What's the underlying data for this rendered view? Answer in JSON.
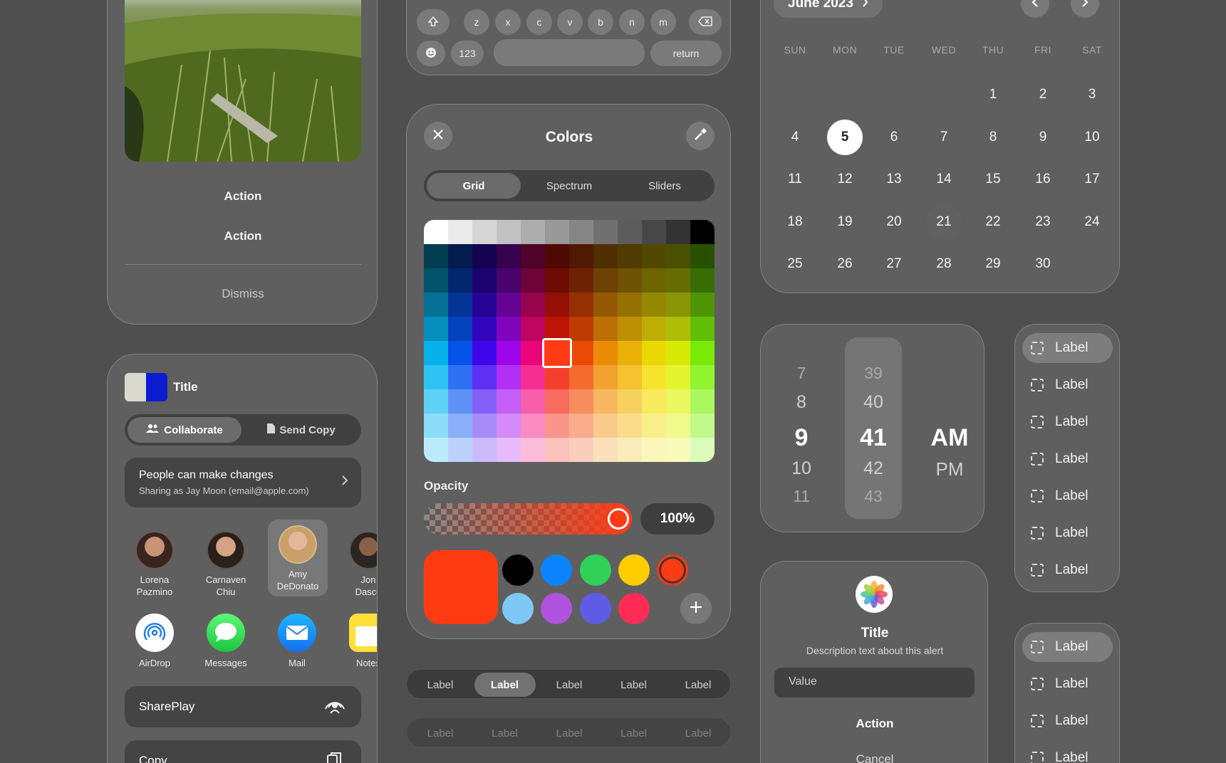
{
  "action_sheet": {
    "action1": "Action",
    "action2": "Action",
    "dismiss": "Dismiss"
  },
  "share": {
    "title": "Title",
    "seg_collaborate": "Collaborate",
    "seg_send_copy": "Send Copy",
    "permission_title": "People can make changes",
    "permission_sub": "Sharing as Jay Moon (email@apple.com)",
    "people": [
      {
        "first": "Lorena",
        "last": "Pazmino"
      },
      {
        "first": "Carnaven",
        "last": "Chiu"
      },
      {
        "first": "Amy",
        "last": "DeDonato"
      },
      {
        "first": "Jon",
        "last": "Dasco"
      }
    ],
    "apps": [
      "AirDrop",
      "Messages",
      "Mail",
      "Notes"
    ],
    "shareplay": "SharePlay",
    "copy": "Copy"
  },
  "keyboard": {
    "row3": [
      "z",
      "x",
      "c",
      "v",
      "b",
      "n",
      "m"
    ],
    "num": "123",
    "return": "return"
  },
  "colors": {
    "title": "Colors",
    "tabs": [
      "Grid",
      "Spectrum",
      "Sliders"
    ],
    "selected_tab": "Grid",
    "opacity_label": "Opacity",
    "opacity_value": "100%",
    "current_color": "#ff3b14",
    "swatches": [
      "#000000",
      "#0a84ff",
      "#30d158",
      "#ffcc00",
      "#ff3b14",
      "#7ec8f5",
      "#af52de",
      "#5e5ce6",
      "#ff2d55"
    ]
  },
  "tabbar_active": {
    "labels": [
      "Label",
      "Label",
      "Label",
      "Label",
      "Label"
    ],
    "selected_index": 1
  },
  "tabbar_disabled": {
    "labels": [
      "Label",
      "Label",
      "Label",
      "Label",
      "Label"
    ]
  },
  "calendar": {
    "month": "June 2023",
    "weekdays": [
      "SUN",
      "MON",
      "TUE",
      "WED",
      "THU",
      "FRI",
      "SAT"
    ],
    "first_weekday_index": 4,
    "days_in_month": 30,
    "selected_day": 5,
    "highlighted_day": 21
  },
  "time_picker": {
    "hours": [
      "7",
      "8",
      "9",
      "10",
      "11"
    ],
    "minutes": [
      "39",
      "40",
      "41",
      "42",
      "43"
    ],
    "meridiem": [
      "AM",
      "PM"
    ],
    "selected_hour": "9",
    "selected_minute": "41",
    "selected_meridiem": "AM"
  },
  "alert": {
    "title": "Title",
    "description": "Description text about this alert",
    "input_value": "Value",
    "action": "Action",
    "cancel": "Cancel"
  },
  "list1": {
    "items": [
      "Label",
      "Label",
      "Label",
      "Label",
      "Label",
      "Label",
      "Label"
    ],
    "selected_index": 0
  },
  "list2": {
    "items": [
      "Label",
      "Label",
      "Label",
      "Label"
    ],
    "selected_index": 0
  }
}
